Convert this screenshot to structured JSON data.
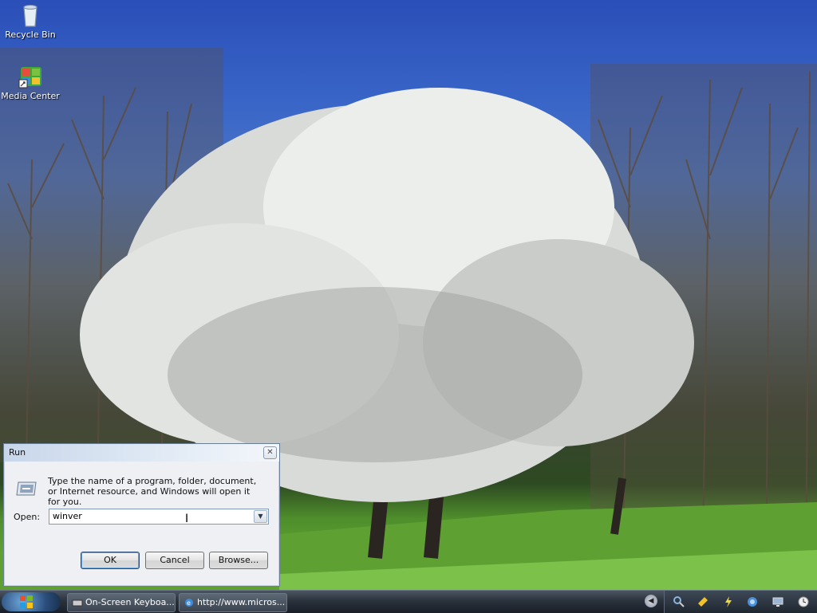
{
  "desktop": {
    "icons": [
      {
        "label": "Recycle Bin",
        "icon": "recycle-bin-icon"
      },
      {
        "label": "Media Center",
        "icon": "media-center-icon"
      }
    ]
  },
  "run_dialog": {
    "title": "Run",
    "description": "Type the name of a program, folder, document, or Internet resource, and Windows will open it for you.",
    "open_label": "Open:",
    "open_value": "winver",
    "ok_label": "OK",
    "cancel_label": "Cancel",
    "browse_label": "Browse..."
  },
  "taskbar": {
    "tasks": [
      {
        "label": "On-Screen Keyboa...",
        "icon": "keyboard-icon"
      },
      {
        "label": "http://www.micros...",
        "icon": "internet-explorer-icon"
      }
    ],
    "tray_icons": [
      "magnifier-icon",
      "pointer-icon",
      "power-icon",
      "network-icon",
      "display-icon",
      "clock-icon"
    ]
  },
  "colors": {
    "sky": "#3a66c8",
    "grass": "#6fb43a",
    "taskbar": "#2a323c"
  }
}
